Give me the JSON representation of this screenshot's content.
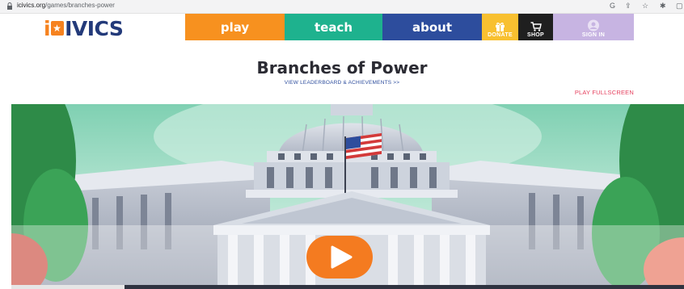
{
  "browser": {
    "url_domain": "icivics.org",
    "url_path": "/games/branches-power"
  },
  "logo": {
    "part1": "i",
    "part2": "IVICS"
  },
  "nav": {
    "play": "play",
    "teach": "teach",
    "about": "about"
  },
  "tiles": {
    "donate": "DONATE",
    "shop": "SHOP",
    "signin": "SIGN IN"
  },
  "page": {
    "title": "Branches of Power",
    "leaderboard_link": "VIEW LEADERBOARD & ACHIEVEMENTS >>",
    "fullscreen_link": "PLAY FULLSCREEN"
  },
  "colors": {
    "play": "#f7911f",
    "teach": "#1eb28e",
    "about": "#2d4d9d",
    "donate": "#f8c030",
    "shop": "#1f1f1f",
    "signin": "#c7b4e2",
    "fullscreen_link": "#e5405e",
    "play_button": "#f47b20"
  },
  "icons": [
    "lock-icon",
    "gift-icon",
    "cart-icon",
    "user-icon",
    "play-icon"
  ]
}
